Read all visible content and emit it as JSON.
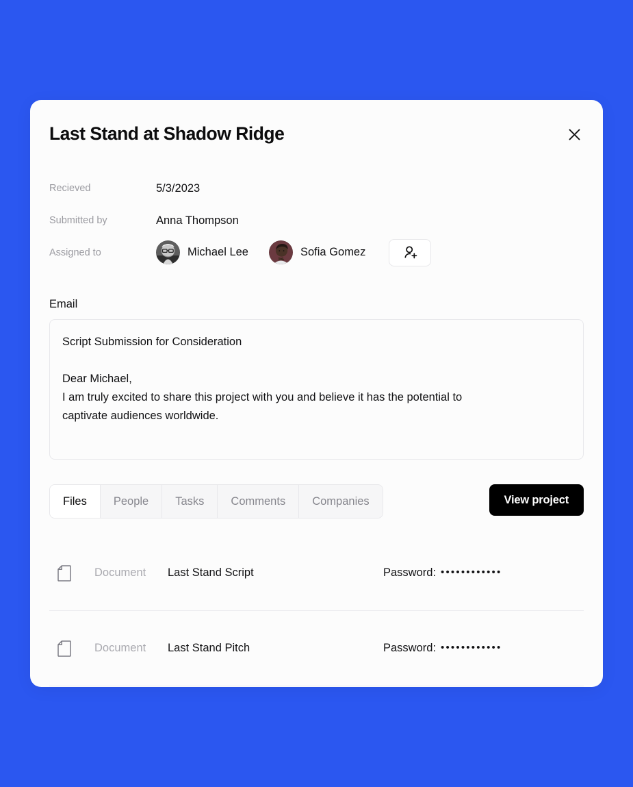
{
  "theme": {
    "background_color": "#2B57F0",
    "card_background": "#FCFCFC",
    "accent_button_color": "#000000",
    "label_color": "#9A9AA0",
    "value_color": "#111113"
  },
  "card": {
    "title": "Last Stand at Shadow Ridge",
    "close_label": "×"
  },
  "meta": {
    "received": {
      "label": "Recieved",
      "value": "5/3/2023"
    },
    "submitted_by": {
      "label": "Submitted by",
      "value": "Anna Thompson"
    },
    "assigned_to": {
      "label": "Assigned to",
      "people": [
        {
          "name": "Michael Lee",
          "avatar": "avatar-michael-lee"
        },
        {
          "name": "Sofia Gomez",
          "avatar": "avatar-sofia-gomez"
        }
      ],
      "add_button_icon": "person-add-icon"
    }
  },
  "email": {
    "label": "Email",
    "body": "Script Submission for Consideration\n\nDear Michael,\nI am truly excited to share this project with you and believe it has the potential to\ncaptivate audiences worldwide."
  },
  "tabs": {
    "items": [
      {
        "label": "Files",
        "active": true
      },
      {
        "label": "People",
        "active": false
      },
      {
        "label": "Tasks",
        "active": false
      },
      {
        "label": "Comments",
        "active": false
      },
      {
        "label": "Companies",
        "active": false
      }
    ],
    "action_button": "View project"
  },
  "files": {
    "password_label": "Password:",
    "rows": [
      {
        "icon": "document-icon",
        "type": "Document",
        "name": "Last Stand Script",
        "password_label": "Password:",
        "password_mask": "••••••••••••"
      },
      {
        "icon": "document-icon",
        "type": "Document",
        "name": "Last Stand Pitch",
        "password_label": "Password:",
        "password_mask": "••••••••••••"
      }
    ]
  }
}
